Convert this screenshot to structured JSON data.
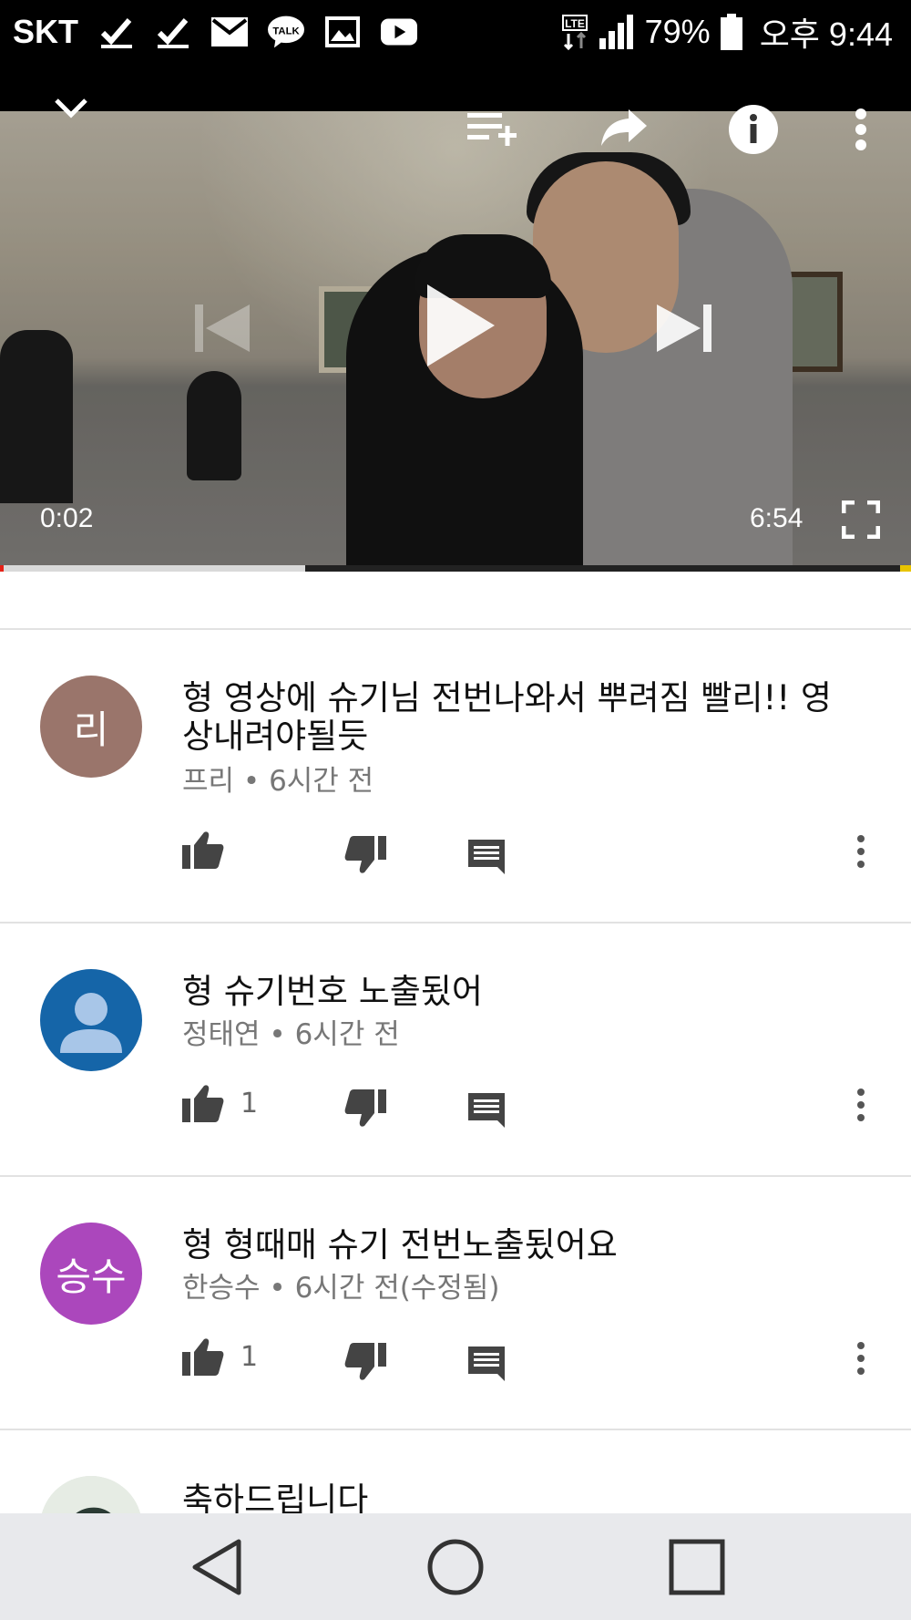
{
  "status_bar": {
    "carrier": "SKT",
    "notification_icons": [
      "check-icon",
      "check-icon",
      "mail-icon",
      "kakao-talk-icon",
      "gallery-icon",
      "youtube-icon"
    ],
    "talk_label": "TALK",
    "network": "LTE",
    "battery_percent": "79%",
    "time": "오후 9:44"
  },
  "player": {
    "current_time": "0:02",
    "duration": "6:54",
    "progress_played": 0.004,
    "progress_buffered": 0.335,
    "accent_color": "#e62117"
  },
  "comments": [
    {
      "avatar_text": "리",
      "avatar_color": "#9a756b",
      "text": "형 영상에 슈기님 전번나와서 뿌려짐 빨리!! 영상내려야될듯",
      "author": "프리",
      "time": "6시간 전",
      "likes": ""
    },
    {
      "avatar_text": "",
      "avatar_color": "#1565a8",
      "text": "형 슈기번호 노출됬어",
      "author": "정태연",
      "time": "6시간 전",
      "likes": "1"
    },
    {
      "avatar_text": "승수",
      "avatar_color": "#ab47bc",
      "text": "형 형때매 슈기 전번노출됬어요",
      "author": "한승수",
      "time": "6시간 전(수정됨)",
      "likes": "1"
    },
    {
      "avatar_text": "",
      "avatar_color": "#d8e0d8",
      "text": "축하드립니다",
      "author": "",
      "time": "",
      "likes": ""
    }
  ],
  "meta_separator": "•"
}
